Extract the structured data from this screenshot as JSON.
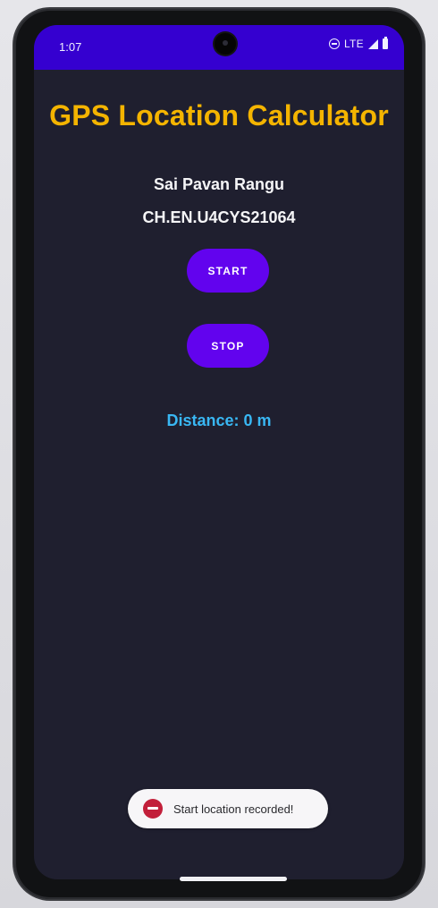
{
  "status_bar": {
    "time": "1:07",
    "network": "LTE",
    "icons": [
      "do-not-disturb-icon",
      "signal-icon",
      "battery-icon"
    ]
  },
  "app": {
    "title": "GPS Location Calculator",
    "name": "Sai Pavan Rangu",
    "roll_number": "CH.EN.U4CYS21064",
    "start_label": "START",
    "stop_label": "STOP",
    "distance_text": "Distance: 0 m"
  },
  "toast": {
    "message": "Start location recorded!",
    "icon": "app-icon"
  },
  "colors": {
    "status_bar": "#3500d0",
    "background": "#1f1f2f",
    "title": "#f4b400",
    "button": "#6203ee",
    "distance": "#39b7f3"
  }
}
